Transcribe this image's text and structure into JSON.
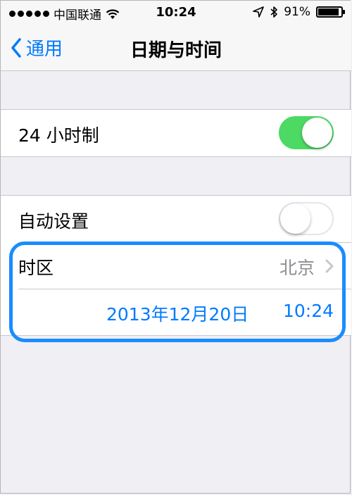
{
  "status_bar": {
    "carrier": "中国联通",
    "time": "10:24",
    "battery": "91%",
    "battery_level": 0.91
  },
  "nav": {
    "back_label": "通用",
    "title": "日期与时间"
  },
  "settings": {
    "hour24": {
      "label": "24 小时制",
      "on": true
    },
    "auto": {
      "label": "自动设置",
      "on": false
    },
    "timezone": {
      "label": "时区",
      "value": "北京"
    },
    "date": "2013年12月20日",
    "time": "10:24"
  },
  "colors": {
    "accent": "#007aff",
    "toggle_on": "#4cd964",
    "highlight": "#1a8cff",
    "background": "#efeff4"
  }
}
